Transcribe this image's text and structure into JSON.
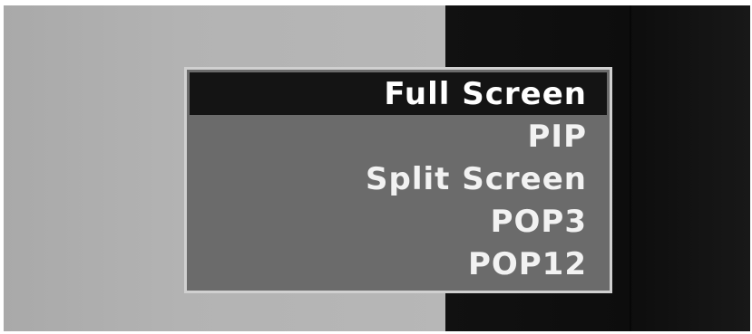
{
  "menu": {
    "selected_index": 0,
    "items": [
      {
        "label": "Full Screen"
      },
      {
        "label": "PIP"
      },
      {
        "label": "Split Screen"
      },
      {
        "label": "POP3"
      },
      {
        "label": "POP12"
      }
    ]
  },
  "colors": {
    "menu_background": "#6b6b6b",
    "selected_background": "#141414",
    "border": "#d0d0d0",
    "text": "#f2f2f2"
  }
}
